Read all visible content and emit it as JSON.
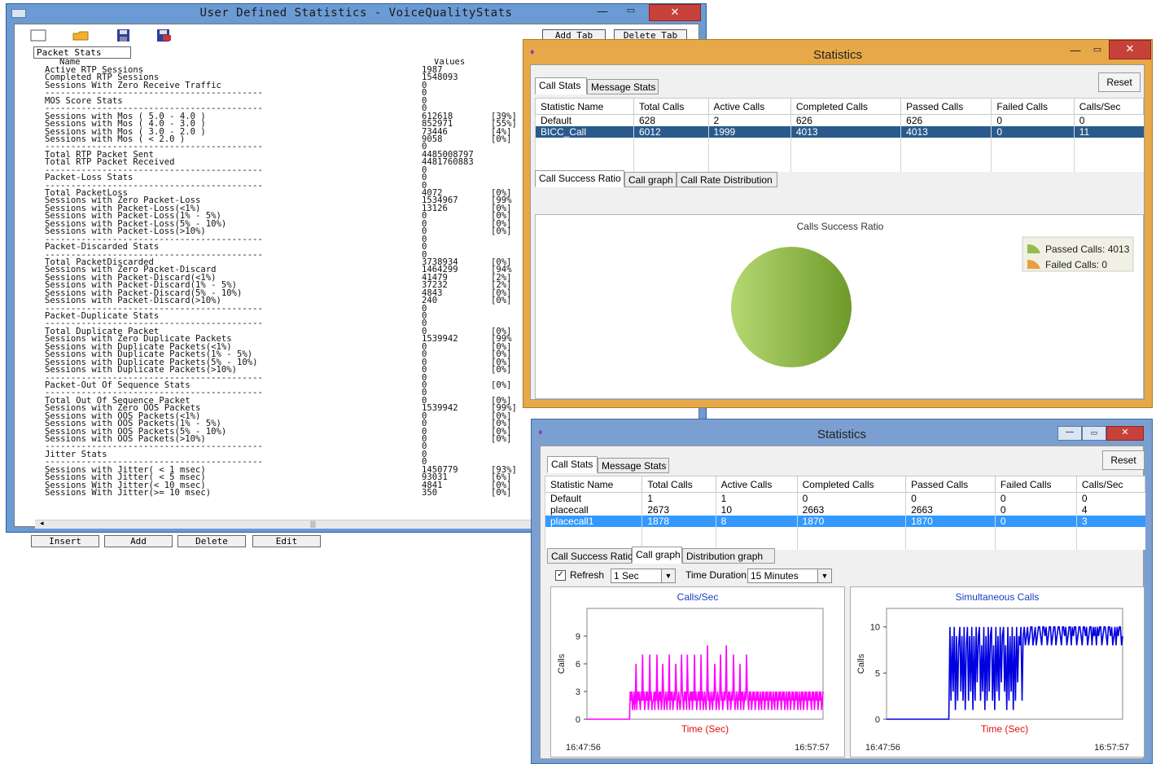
{
  "win1": {
    "title": "User Defined Statistics - VoiceQualityStats",
    "add_tab": "Add Tab",
    "delete_tab": "Delete Tab",
    "tab": "Packet Stats",
    "col_name": "Name",
    "col_values": "Values",
    "rows": [
      [
        "Active RTP Sessions",
        "1987",
        ""
      ],
      [
        "Completed RTP Sessions",
        "1548093",
        ""
      ],
      [
        "Sessions With Zero Receive Traffic",
        "0",
        ""
      ],
      [
        "------------------------------------------",
        "0",
        ""
      ],
      [
        "MOS Score Stats",
        "0",
        ""
      ],
      [
        "------------------------------------------",
        "0",
        ""
      ],
      [
        "Sessions with Mos ( 5.0 - 4.0 )",
        "612618",
        "[39%]"
      ],
      [
        "Sessions with Mos ( 4.0 - 3.0 )",
        "852971",
        "[55%]"
      ],
      [
        "Sessions with Mos ( 3.0 - 2.0 )",
        "73446",
        "[4%]"
      ],
      [
        "Sessions with Mos ( < 2.0 )",
        "9058",
        "[0%]"
      ],
      [
        "------------------------------------------",
        "0",
        ""
      ],
      [
        "Total RTP Packet Sent",
        "4485008797",
        ""
      ],
      [
        "Total RTP Packet Received",
        "4481760883",
        ""
      ],
      [
        "------------------------------------------",
        "0",
        ""
      ],
      [
        "Packet-Loss Stats",
        "0",
        ""
      ],
      [
        "------------------------------------------",
        "0",
        ""
      ],
      [
        "Total PacketLoss",
        "4072",
        "[0%]"
      ],
      [
        "Sessions with Zero Packet-Loss",
        "1534967",
        "[99%"
      ],
      [
        "Sessions with Packet-Loss(<1%)",
        "13126",
        "[0%]"
      ],
      [
        "Sessions with Packet-Loss(1% - 5%)",
        "0",
        "[0%]"
      ],
      [
        "Sessions with Packet-Loss(5% - 10%)",
        "0",
        "[0%]"
      ],
      [
        "Sessions with Packet-Loss(>10%)",
        "0",
        "[0%]"
      ],
      [
        "------------------------------------------",
        "0",
        ""
      ],
      [
        "Packet-Discarded Stats",
        "0",
        ""
      ],
      [
        "------------------------------------------",
        "0",
        ""
      ],
      [
        "Total PacketDiscarded",
        "3738934",
        "[0%]"
      ],
      [
        "Sessions with Zero Packet-Discard",
        "1464299",
        "[94%"
      ],
      [
        "Sessions with Packet-Discard(<1%)",
        "41479",
        "[2%]"
      ],
      [
        "Sessions with Packet-Discard(1% - 5%)",
        "37232",
        "[2%]"
      ],
      [
        "Sessions with Packet-Discard(5% - 10%)",
        "4843",
        "[0%]"
      ],
      [
        "Sessions with Packet-Discard(>10%)",
        "240",
        "[0%]"
      ],
      [
        "------------------------------------------",
        "0",
        ""
      ],
      [
        "Packet-Duplicate Stats",
        "0",
        ""
      ],
      [
        "------------------------------------------",
        "0",
        ""
      ],
      [
        "Total Duplicate Packet",
        "0",
        "[0%]"
      ],
      [
        "Sessions with Zero Duplicate Packets",
        "1539942",
        "[99%"
      ],
      [
        "Sessions with Duplicate Packets(<1%)",
        "0",
        "[0%]"
      ],
      [
        "Sessions with Duplicate Packets(1% - 5%)",
        "0",
        "[0%]"
      ],
      [
        "Sessions with Duplicate Packets(5% - 10%)",
        "0",
        "[0%]"
      ],
      [
        "Sessions with Duplicate Packets(>10%)",
        "0",
        "[0%]"
      ],
      [
        "------------------------------------------",
        "0",
        ""
      ],
      [
        "Packet-Out Of Sequence Stats",
        "0",
        "[0%]"
      ],
      [
        "------------------------------------------",
        "0",
        ""
      ],
      [
        "Total Out Of Sequence Packet",
        "0",
        "[0%]"
      ],
      [
        "Sessions with Zero OOS Packets",
        "1539942",
        "[99%]"
      ],
      [
        "Sessions with OOS Packets(<1%)",
        "0",
        "[0%]"
      ],
      [
        "Sessions with OOS Packets(1% - 5%)",
        "0",
        "[0%]"
      ],
      [
        "Sessions with OOS Packets(5% - 10%)",
        "0",
        "[0%]"
      ],
      [
        "Sessions with OOS Packets(>10%)",
        "0",
        "[0%]"
      ],
      [
        "------------------------------------------",
        "0",
        ""
      ],
      [
        "Jitter Stats",
        "0",
        ""
      ],
      [
        "------------------------------------------",
        "0",
        ""
      ],
      [
        "Sessions with Jitter( < 1 msec)",
        "1450779",
        "[93%]"
      ],
      [
        "Sessions with Jitter( < 5 msec)",
        "93031",
        "[6%]"
      ],
      [
        "Sessions With Jitter(< 10 msec)",
        "4841",
        "[0%]"
      ],
      [
        "Sessions With Jitter(>= 10 msec)",
        "350",
        "[0%]"
      ]
    ],
    "buttons": [
      "Insert",
      "Add",
      "Delete",
      "Edit"
    ]
  },
  "win2": {
    "title": "Statistics",
    "tabs": [
      "Call Stats",
      "Message Stats"
    ],
    "reset": "Reset",
    "columns": [
      "Statistic Name",
      "Total Calls",
      "Active Calls",
      "Completed Calls",
      "Passed Calls",
      "Failed Calls",
      "Calls/Sec"
    ],
    "rows": [
      [
        "Default",
        "628",
        "2",
        "626",
        "626",
        "0",
        "0"
      ],
      [
        "BICC_Call",
        "6012",
        "1999",
        "4013",
        "4013",
        "0",
        "11"
      ]
    ],
    "subtabs": [
      "Call Success Ratio",
      "Call graph",
      "Call Rate Distribution"
    ],
    "pie_title": "Calls Success Ratio",
    "legend": [
      "Passed Calls: 4013",
      "Failed Calls: 0"
    ]
  },
  "win3": {
    "title": "Statistics",
    "tabs": [
      "Call Stats",
      "Message Stats"
    ],
    "reset": "Reset",
    "columns": [
      "Statistic Name",
      "Total Calls",
      "Active Calls",
      "Completed Calls",
      "Passed Calls",
      "Failed Calls",
      "Calls/Sec"
    ],
    "rows": [
      [
        "Default",
        "1",
        "1",
        "0",
        "0",
        "0",
        "0"
      ],
      [
        "placecall",
        "2673",
        "10",
        "2663",
        "2663",
        "0",
        "4"
      ],
      [
        "placecall1",
        "1878",
        "8",
        "1870",
        "1870",
        "0",
        "3"
      ]
    ],
    "subtabs": [
      "Call Success Ratio",
      "Call graph",
      "Distribution graph"
    ],
    "refresh_label": "Refresh",
    "refresh_value": "1 Sec",
    "duration_label": "Time Duration",
    "duration_value": "15 Minutes",
    "start_time": "16:47:56",
    "end_time": "16:57:57"
  },
  "chart_data": [
    {
      "type": "pie",
      "title": "Calls Success Ratio",
      "categories": [
        "Passed Calls: 4013",
        "Failed Calls: 0"
      ],
      "values": [
        4013,
        0
      ],
      "colors": [
        "#8fbf48",
        "#e6a040"
      ],
      "legend": "right"
    },
    {
      "type": "line",
      "title": "Calls/Sec",
      "xlabel": "Time (Sec)",
      "ylabel": "Calls",
      "ylim": [
        0,
        12
      ],
      "yticks": [
        0,
        3,
        6,
        9
      ],
      "xrange": [
        "16:47:56",
        "16:57:57"
      ],
      "color": "#ff00ff",
      "series": [
        {
          "values": [
            0,
            0,
            0,
            0,
            0,
            0,
            0,
            0,
            0,
            0,
            0,
            0,
            0,
            0,
            0,
            0,
            0,
            0,
            0,
            0,
            0,
            0,
            0,
            0,
            0,
            0,
            0,
            0,
            0,
            0,
            0,
            0,
            0,
            0,
            0,
            0,
            0,
            0,
            0,
            0,
            0,
            0,
            0,
            0,
            0,
            0,
            0,
            0,
            0,
            0,
            0,
            0,
            0,
            0,
            0,
            0,
            0,
            0,
            0,
            0,
            3,
            2,
            3,
            1,
            2,
            3,
            1,
            2,
            6,
            1,
            3,
            2,
            3,
            2,
            1,
            3,
            2,
            7,
            2,
            3,
            1,
            2,
            3,
            2,
            3,
            1,
            2,
            7,
            2,
            3,
            1,
            2,
            2,
            3,
            1,
            3,
            2,
            7,
            2,
            1,
            3,
            2,
            3,
            1,
            2,
            6,
            3,
            1,
            2,
            3,
            2,
            1,
            3,
            2,
            7,
            1,
            3,
            2,
            3,
            1,
            2,
            3,
            2,
            6,
            3,
            1,
            2,
            3,
            2,
            1,
            2,
            7,
            3,
            2,
            1,
            3,
            2,
            3,
            1,
            7,
            3,
            2,
            1,
            3,
            2,
            3,
            1,
            3,
            2,
            7,
            2,
            3,
            1,
            2,
            3,
            2,
            3,
            1,
            7,
            2,
            3,
            1,
            2,
            3,
            2,
            1,
            3,
            8,
            2,
            3,
            1,
            2,
            3,
            2,
            1,
            3,
            2,
            6,
            3,
            1,
            2,
            3,
            2,
            1,
            3,
            7,
            2,
            3,
            1,
            2,
            3,
            2,
            3,
            8,
            2,
            1,
            3,
            2,
            3,
            1,
            2,
            3,
            2,
            7,
            3,
            1,
            2,
            3,
            2,
            1,
            3,
            2,
            6,
            1,
            3,
            2,
            3,
            1,
            2,
            3,
            2,
            7,
            3,
            2,
            1,
            3,
            2,
            3,
            1,
            2,
            3,
            2,
            3,
            1,
            2,
            3,
            2,
            3,
            1,
            2,
            3,
            2,
            1,
            3,
            2,
            3,
            1,
            2,
            3,
            2,
            3,
            1,
            2,
            3,
            2,
            3,
            1,
            2,
            3,
            2,
            1,
            3,
            2,
            3,
            1,
            2,
            3,
            2,
            3,
            1,
            2,
            3,
            2,
            3,
            1,
            2,
            3,
            2,
            1,
            3,
            2,
            3,
            1,
            2,
            3,
            2,
            3,
            1,
            2,
            3,
            2,
            3,
            1,
            2,
            3,
            2,
            1,
            3,
            2,
            3,
            1,
            2,
            3,
            2,
            3,
            1,
            2,
            3,
            2,
            3,
            2,
            1,
            3,
            2,
            3,
            1,
            2,
            3,
            2,
            3,
            1,
            2,
            3,
            2,
            3,
            1,
            2,
            3
          ]
        }
      ]
    },
    {
      "type": "line",
      "title": "Simultaneous Calls",
      "xlabel": "Time (Sec)",
      "ylabel": "Calls",
      "ylim": [
        0,
        12
      ],
      "yticks": [
        0,
        5,
        10
      ],
      "xrange": [
        "16:47:56",
        "16:57:57"
      ],
      "color": "#0000e0",
      "series": [
        {
          "values": [
            0,
            0,
            0,
            0,
            0,
            0,
            0,
            0,
            0,
            0,
            0,
            0,
            0,
            0,
            0,
            0,
            0,
            0,
            0,
            0,
            0,
            0,
            0,
            0,
            0,
            0,
            0,
            0,
            0,
            0,
            0,
            0,
            0,
            0,
            0,
            0,
            0,
            0,
            0,
            0,
            0,
            0,
            0,
            0,
            0,
            0,
            0,
            0,
            0,
            0,
            0,
            0,
            0,
            0,
            0,
            0,
            0,
            0,
            10,
            2,
            9,
            3,
            10,
            1,
            9,
            2,
            8,
            10,
            3,
            9,
            2,
            10,
            1,
            8,
            10,
            2,
            9,
            3,
            10,
            1,
            9,
            2,
            10,
            4,
            9,
            10,
            2,
            8,
            3,
            10,
            1,
            9,
            2,
            10,
            3,
            9,
            10,
            2,
            8,
            1,
            10,
            3,
            9,
            2,
            10,
            4,
            9,
            10,
            3,
            8,
            1,
            10,
            2,
            9,
            3,
            10,
            1,
            9,
            2,
            10,
            4,
            9,
            8,
            10,
            2,
            9,
            10,
            8,
            9,
            10,
            8,
            9,
            10,
            10,
            8,
            9,
            10,
            8,
            9,
            10,
            10,
            9,
            8,
            10,
            10,
            9,
            10,
            8,
            9,
            10,
            10,
            8,
            9,
            10,
            10,
            8,
            9,
            10,
            10,
            9,
            8,
            10,
            10,
            9,
            10,
            8,
            9,
            10,
            10,
            8,
            10,
            9,
            10,
            10,
            8,
            9,
            10,
            10,
            9,
            8,
            10,
            10,
            9,
            10,
            8,
            9,
            10,
            10,
            8,
            10,
            9,
            10,
            8,
            10,
            9,
            10,
            10,
            8,
            9,
            10,
            10,
            9,
            8,
            10,
            10,
            9,
            10,
            8,
            9,
            10,
            8,
            10,
            9,
            10,
            10,
            8,
            9
          ]
        }
      ]
    }
  ]
}
